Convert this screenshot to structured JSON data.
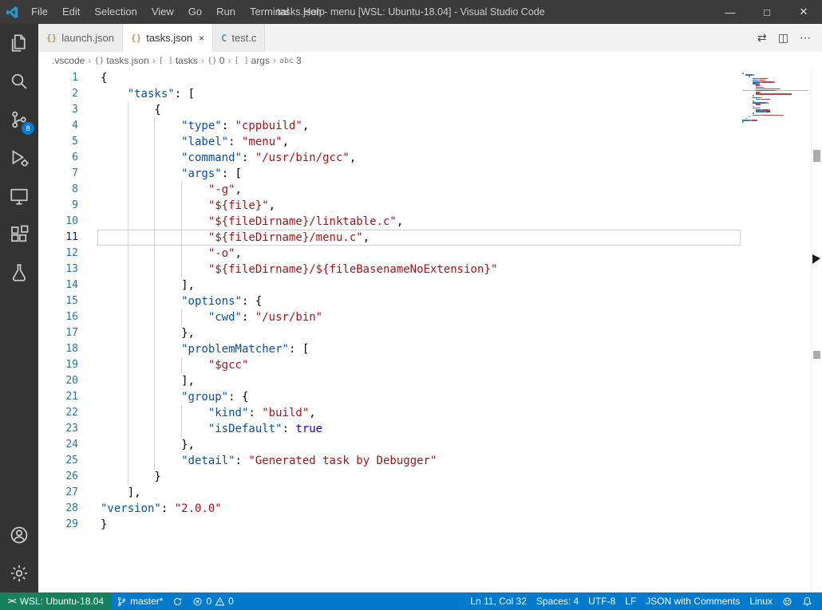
{
  "title_bar": {
    "menus": [
      "File",
      "Edit",
      "Selection",
      "View",
      "Go",
      "Run",
      "Terminal",
      "Help"
    ],
    "title": "tasks.json - menu [WSL: Ubuntu-18.04] - Visual Studio Code",
    "controls": {
      "minimize": "—",
      "maximize": "□",
      "close": "✕"
    }
  },
  "activity_bar": {
    "source_control_badge": "8"
  },
  "tabs": [
    {
      "icon": "{}",
      "label": "launch.json"
    },
    {
      "icon": "{}",
      "label": "tasks.json",
      "close": "×"
    },
    {
      "icon": "C",
      "label": "test.c"
    }
  ],
  "tab_actions": {
    "open_changes": "⇄",
    "split_editor": "◫",
    "more": "⋯"
  },
  "breadcrumbs": {
    "separator": "›",
    "items": [
      {
        "label": ".vscode"
      },
      {
        "icon": "{}",
        "label": "tasks.json"
      },
      {
        "icon": "[ ]",
        "label": "tasks"
      },
      {
        "icon": "{}",
        "label": "0"
      },
      {
        "icon": "[ ]",
        "label": "args"
      },
      {
        "icon": "abc",
        "label": "3"
      }
    ]
  },
  "editor": {
    "lines": [
      {
        "n": 1,
        "indent": 0,
        "t": [
          [
            "p",
            "{"
          ]
        ]
      },
      {
        "n": 2,
        "indent": 1,
        "t": [
          [
            "k",
            "\"tasks\""
          ],
          [
            "p",
            ": ["
          ]
        ]
      },
      {
        "n": 3,
        "indent": 2,
        "t": [
          [
            "p",
            "{"
          ]
        ]
      },
      {
        "n": 4,
        "indent": 3,
        "t": [
          [
            "k",
            "\"type\""
          ],
          [
            "p",
            ": "
          ],
          [
            "s",
            "\"cppbuild\""
          ],
          [
            "p",
            ","
          ]
        ]
      },
      {
        "n": 5,
        "indent": 3,
        "t": [
          [
            "k",
            "\"label\""
          ],
          [
            "p",
            ": "
          ],
          [
            "s",
            "\"menu\""
          ],
          [
            "p",
            ","
          ]
        ]
      },
      {
        "n": 6,
        "indent": 3,
        "t": [
          [
            "k",
            "\"command\""
          ],
          [
            "p",
            ": "
          ],
          [
            "s",
            "\"/usr/bin/gcc\""
          ],
          [
            "p",
            ","
          ]
        ]
      },
      {
        "n": 7,
        "indent": 3,
        "t": [
          [
            "k",
            "\"args\""
          ],
          [
            "p",
            ": ["
          ]
        ]
      },
      {
        "n": 8,
        "indent": 4,
        "t": [
          [
            "s",
            "\"-g\""
          ],
          [
            "p",
            ","
          ]
        ]
      },
      {
        "n": 9,
        "indent": 4,
        "t": [
          [
            "s",
            "\"${file}\""
          ],
          [
            "p",
            ","
          ]
        ]
      },
      {
        "n": 10,
        "indent": 4,
        "t": [
          [
            "s",
            "\"${fileDirname}/linktable.c\""
          ],
          [
            "p",
            ","
          ]
        ]
      },
      {
        "n": 11,
        "indent": 4,
        "t": [
          [
            "s",
            "\"${fileDirname}/menu.c\""
          ],
          [
            "p",
            ","
          ]
        ],
        "active": true
      },
      {
        "n": 12,
        "indent": 4,
        "t": [
          [
            "s",
            "\"-o\""
          ],
          [
            "p",
            ","
          ]
        ]
      },
      {
        "n": 13,
        "indent": 4,
        "t": [
          [
            "s",
            "\"${fileDirname}/${fileBasenameNoExtension}\""
          ]
        ]
      },
      {
        "n": 14,
        "indent": 3,
        "t": [
          [
            "p",
            "],"
          ]
        ]
      },
      {
        "n": 15,
        "indent": 3,
        "t": [
          [
            "k",
            "\"options\""
          ],
          [
            "p",
            ": {"
          ]
        ]
      },
      {
        "n": 16,
        "indent": 4,
        "t": [
          [
            "k",
            "\"cwd\""
          ],
          [
            "p",
            ": "
          ],
          [
            "s",
            "\"/usr/bin\""
          ]
        ]
      },
      {
        "n": 17,
        "indent": 3,
        "t": [
          [
            "p",
            "},"
          ]
        ]
      },
      {
        "n": 18,
        "indent": 3,
        "t": [
          [
            "k",
            "\"problemMatcher\""
          ],
          [
            "p",
            ": ["
          ]
        ]
      },
      {
        "n": 19,
        "indent": 4,
        "t": [
          [
            "s",
            "\"$gcc\""
          ]
        ]
      },
      {
        "n": 20,
        "indent": 3,
        "t": [
          [
            "p",
            "],"
          ]
        ]
      },
      {
        "n": 21,
        "indent": 3,
        "t": [
          [
            "k",
            "\"group\""
          ],
          [
            "p",
            ": {"
          ]
        ]
      },
      {
        "n": 22,
        "indent": 4,
        "t": [
          [
            "k",
            "\"kind\""
          ],
          [
            "p",
            ": "
          ],
          [
            "s",
            "\"build\""
          ],
          [
            "p",
            ","
          ]
        ]
      },
      {
        "n": 23,
        "indent": 4,
        "t": [
          [
            "k",
            "\"isDefault\""
          ],
          [
            "p",
            ": "
          ],
          [
            "b",
            "true"
          ]
        ]
      },
      {
        "n": 24,
        "indent": 3,
        "t": [
          [
            "p",
            "},"
          ]
        ]
      },
      {
        "n": 25,
        "indent": 3,
        "t": [
          [
            "k",
            "\"detail\""
          ],
          [
            "p",
            ": "
          ],
          [
            "s",
            "\"Generated task by Debugger\""
          ]
        ]
      },
      {
        "n": 26,
        "indent": 2,
        "t": [
          [
            "p",
            "}"
          ]
        ]
      },
      {
        "n": 27,
        "indent": 1,
        "t": [
          [
            "p",
            "],"
          ]
        ]
      },
      {
        "n": 28,
        "indent": 0,
        "t": [
          [
            "k",
            "\"version\""
          ],
          [
            "p",
            ": "
          ],
          [
            "s",
            "\"2.0.0\""
          ]
        ]
      },
      {
        "n": 29,
        "indent": 0,
        "t": [
          [
            "p",
            "}"
          ]
        ]
      }
    ]
  },
  "status_bar": {
    "remote_glyph": "><",
    "remote": "WSL: Ubuntu-18.04",
    "branch": "master*",
    "errors": "0",
    "warnings": "0",
    "cursor": "Ln 11, Col 32",
    "indentation": "Spaces: 4",
    "encoding": "UTF-8",
    "eol": "LF",
    "language": "JSON with Comments",
    "os": "Linux"
  },
  "colors": {
    "accent": "#007acc",
    "remote_background": "#16825d",
    "badge": "#007acc"
  }
}
